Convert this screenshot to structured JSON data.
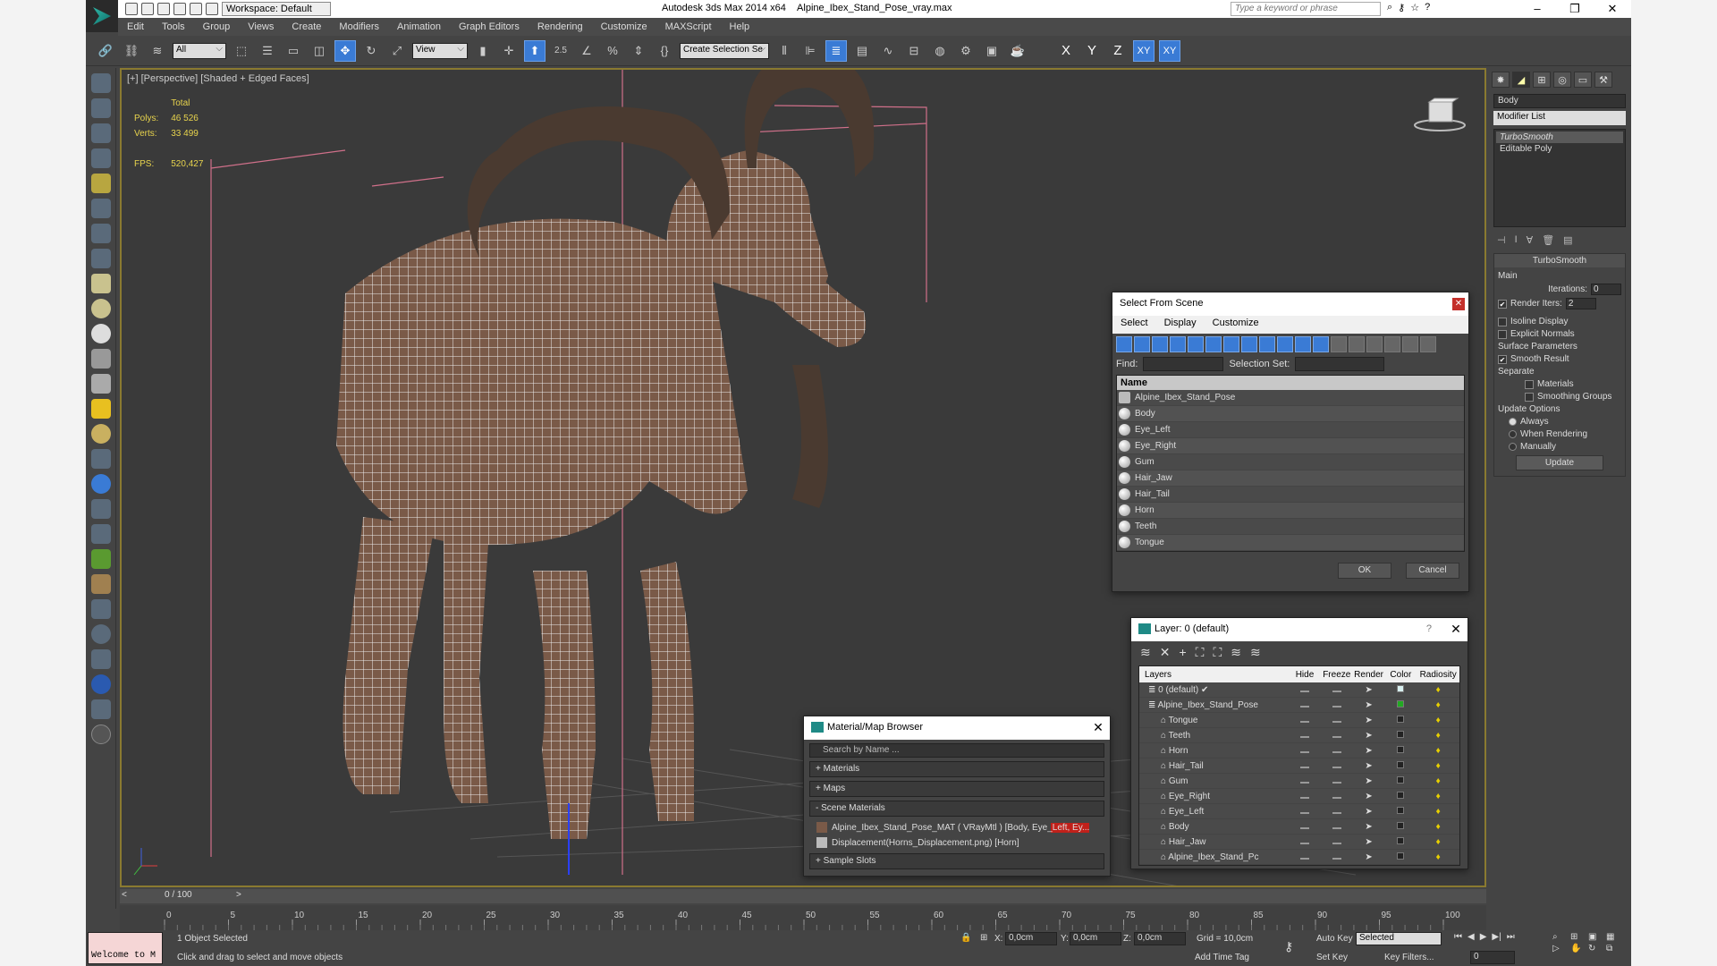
{
  "titlebar": {
    "app_title": "Autodesk 3ds Max  2014 x64",
    "file_name": "Alpine_Ibex_Stand_Pose_vray.max",
    "workspace": "Workspace: Default",
    "search_placeholder": "Type a keyword or phrase",
    "window_controls": [
      "minimize",
      "maximize",
      "close"
    ]
  },
  "menubar": [
    "Edit",
    "Tools",
    "Group",
    "Views",
    "Create",
    "Modifiers",
    "Animation",
    "Graph Editors",
    "Rendering",
    "Customize",
    "MAXScript",
    "Help"
  ],
  "toolbar": {
    "selection_filter": "All",
    "reference_coord": "View",
    "snap_angle_label": "2.5",
    "named_selection_placeholder": "Create Selection Se",
    "axis_labels": [
      "X",
      "Y",
      "Z",
      "XY",
      "XY"
    ]
  },
  "viewport": {
    "label": "[+] [Perspective] [Shaded + Edged Faces]",
    "stats": {
      "header": "Total",
      "polys_label": "Polys:",
      "polys": "46 526",
      "verts_label": "Verts:",
      "verts": "33 499",
      "fps_label": "FPS:",
      "fps": "520,427"
    }
  },
  "command_panel": {
    "object_name": "Body",
    "modifier_list": "Modifier List",
    "stack": [
      "TurboSmooth",
      "Editable Poly"
    ],
    "turbosmooth": {
      "title": "TurboSmooth",
      "main_label": "Main",
      "iterations_label": "Iterations:",
      "iterations": "0",
      "render_iters_label": "Render Iters:",
      "render_iters": "2",
      "render_iters_checked": true,
      "isoline_label": "Isoline Display",
      "explicit_normals_label": "Explicit Normals",
      "surface_params_label": "Surface Parameters",
      "smooth_result_label": "Smooth Result",
      "smooth_result_checked": true,
      "separate_label": "Separate",
      "materials_label": "Materials",
      "smoothing_groups_label": "Smoothing Groups",
      "update_options_label": "Update Options",
      "always_label": "Always",
      "when_rendering_label": "When Rendering",
      "manually_label": "Manually",
      "update_button": "Update",
      "selected_update": "Always"
    }
  },
  "select_from_scene": {
    "title": "Select From Scene",
    "menu": [
      "Select",
      "Display",
      "Customize"
    ],
    "find_label": "Find:",
    "selection_set_label": "Selection Set:",
    "column_name": "Name",
    "items": [
      "Alpine_Ibex_Stand_Pose",
      "Body",
      "Eye_Left",
      "Eye_Right",
      "Gum",
      "Hair_Jaw",
      "Hair_Tail",
      "Horn",
      "Teeth",
      "Tongue"
    ],
    "ok_label": "OK",
    "cancel_label": "Cancel"
  },
  "layer_dialog": {
    "title": "Layer: 0 (default)",
    "help": "?",
    "columns": [
      "Layers",
      "Hide",
      "Freeze",
      "Render",
      "Color",
      "Radiosity"
    ],
    "rows": [
      {
        "name": "0 (default)",
        "color": "#d8f0f0",
        "current": true
      },
      {
        "name": "Alpine_Ibex_Stand_Pose",
        "color": "#22aa22",
        "current": false
      },
      {
        "name": "Tongue",
        "color": "#222222"
      },
      {
        "name": "Teeth",
        "color": "#222222"
      },
      {
        "name": "Horn",
        "color": "#222222"
      },
      {
        "name": "Hair_Tail",
        "color": "#222222"
      },
      {
        "name": "Gum",
        "color": "#222222"
      },
      {
        "name": "Eye_Right",
        "color": "#222222"
      },
      {
        "name": "Eye_Left",
        "color": "#222222"
      },
      {
        "name": "Body",
        "color": "#222222"
      },
      {
        "name": "Hair_Jaw",
        "color": "#222222"
      },
      {
        "name": "Alpine_Ibex_Stand_Pc",
        "color": "#222222"
      }
    ]
  },
  "material_browser": {
    "title": "Material/Map Browser",
    "search_placeholder": "Search by Name ...",
    "sections": [
      "+ Materials",
      "+ Maps",
      "- Scene Materials",
      "+ Sample Slots"
    ],
    "scene_materials": [
      "Alpine_Ibex_Stand_Pose_MAT ( VRayMtl ) [Body, Eye_Left, Ey...",
      "Displacement(Horns_Displacement.png) [Horn]"
    ]
  },
  "timeline": {
    "frame_readout": "0 / 100",
    "ticks": [
      "0",
      "5",
      "10",
      "15",
      "20",
      "25",
      "30",
      "35",
      "40",
      "45",
      "50",
      "55",
      "60",
      "65",
      "70",
      "75",
      "80",
      "85",
      "90",
      "95",
      "100"
    ]
  },
  "statusbar": {
    "maxscript_listener": "Welcome to M",
    "selection_status": "1 Object Selected",
    "prompt": "Click and drag to select and move objects",
    "x_label": "X:",
    "x": "0,0cm",
    "y_label": "Y:",
    "y": "0,0cm",
    "z_label": "Z:",
    "z": "0,0cm",
    "grid": "Grid = 10,0cm",
    "add_time_tag": "Add Time Tag",
    "auto_key": "Auto Key",
    "set_key": "Set Key",
    "key_mode": "Selected",
    "key_filters": "Key Filters...",
    "current_frame": "0"
  }
}
